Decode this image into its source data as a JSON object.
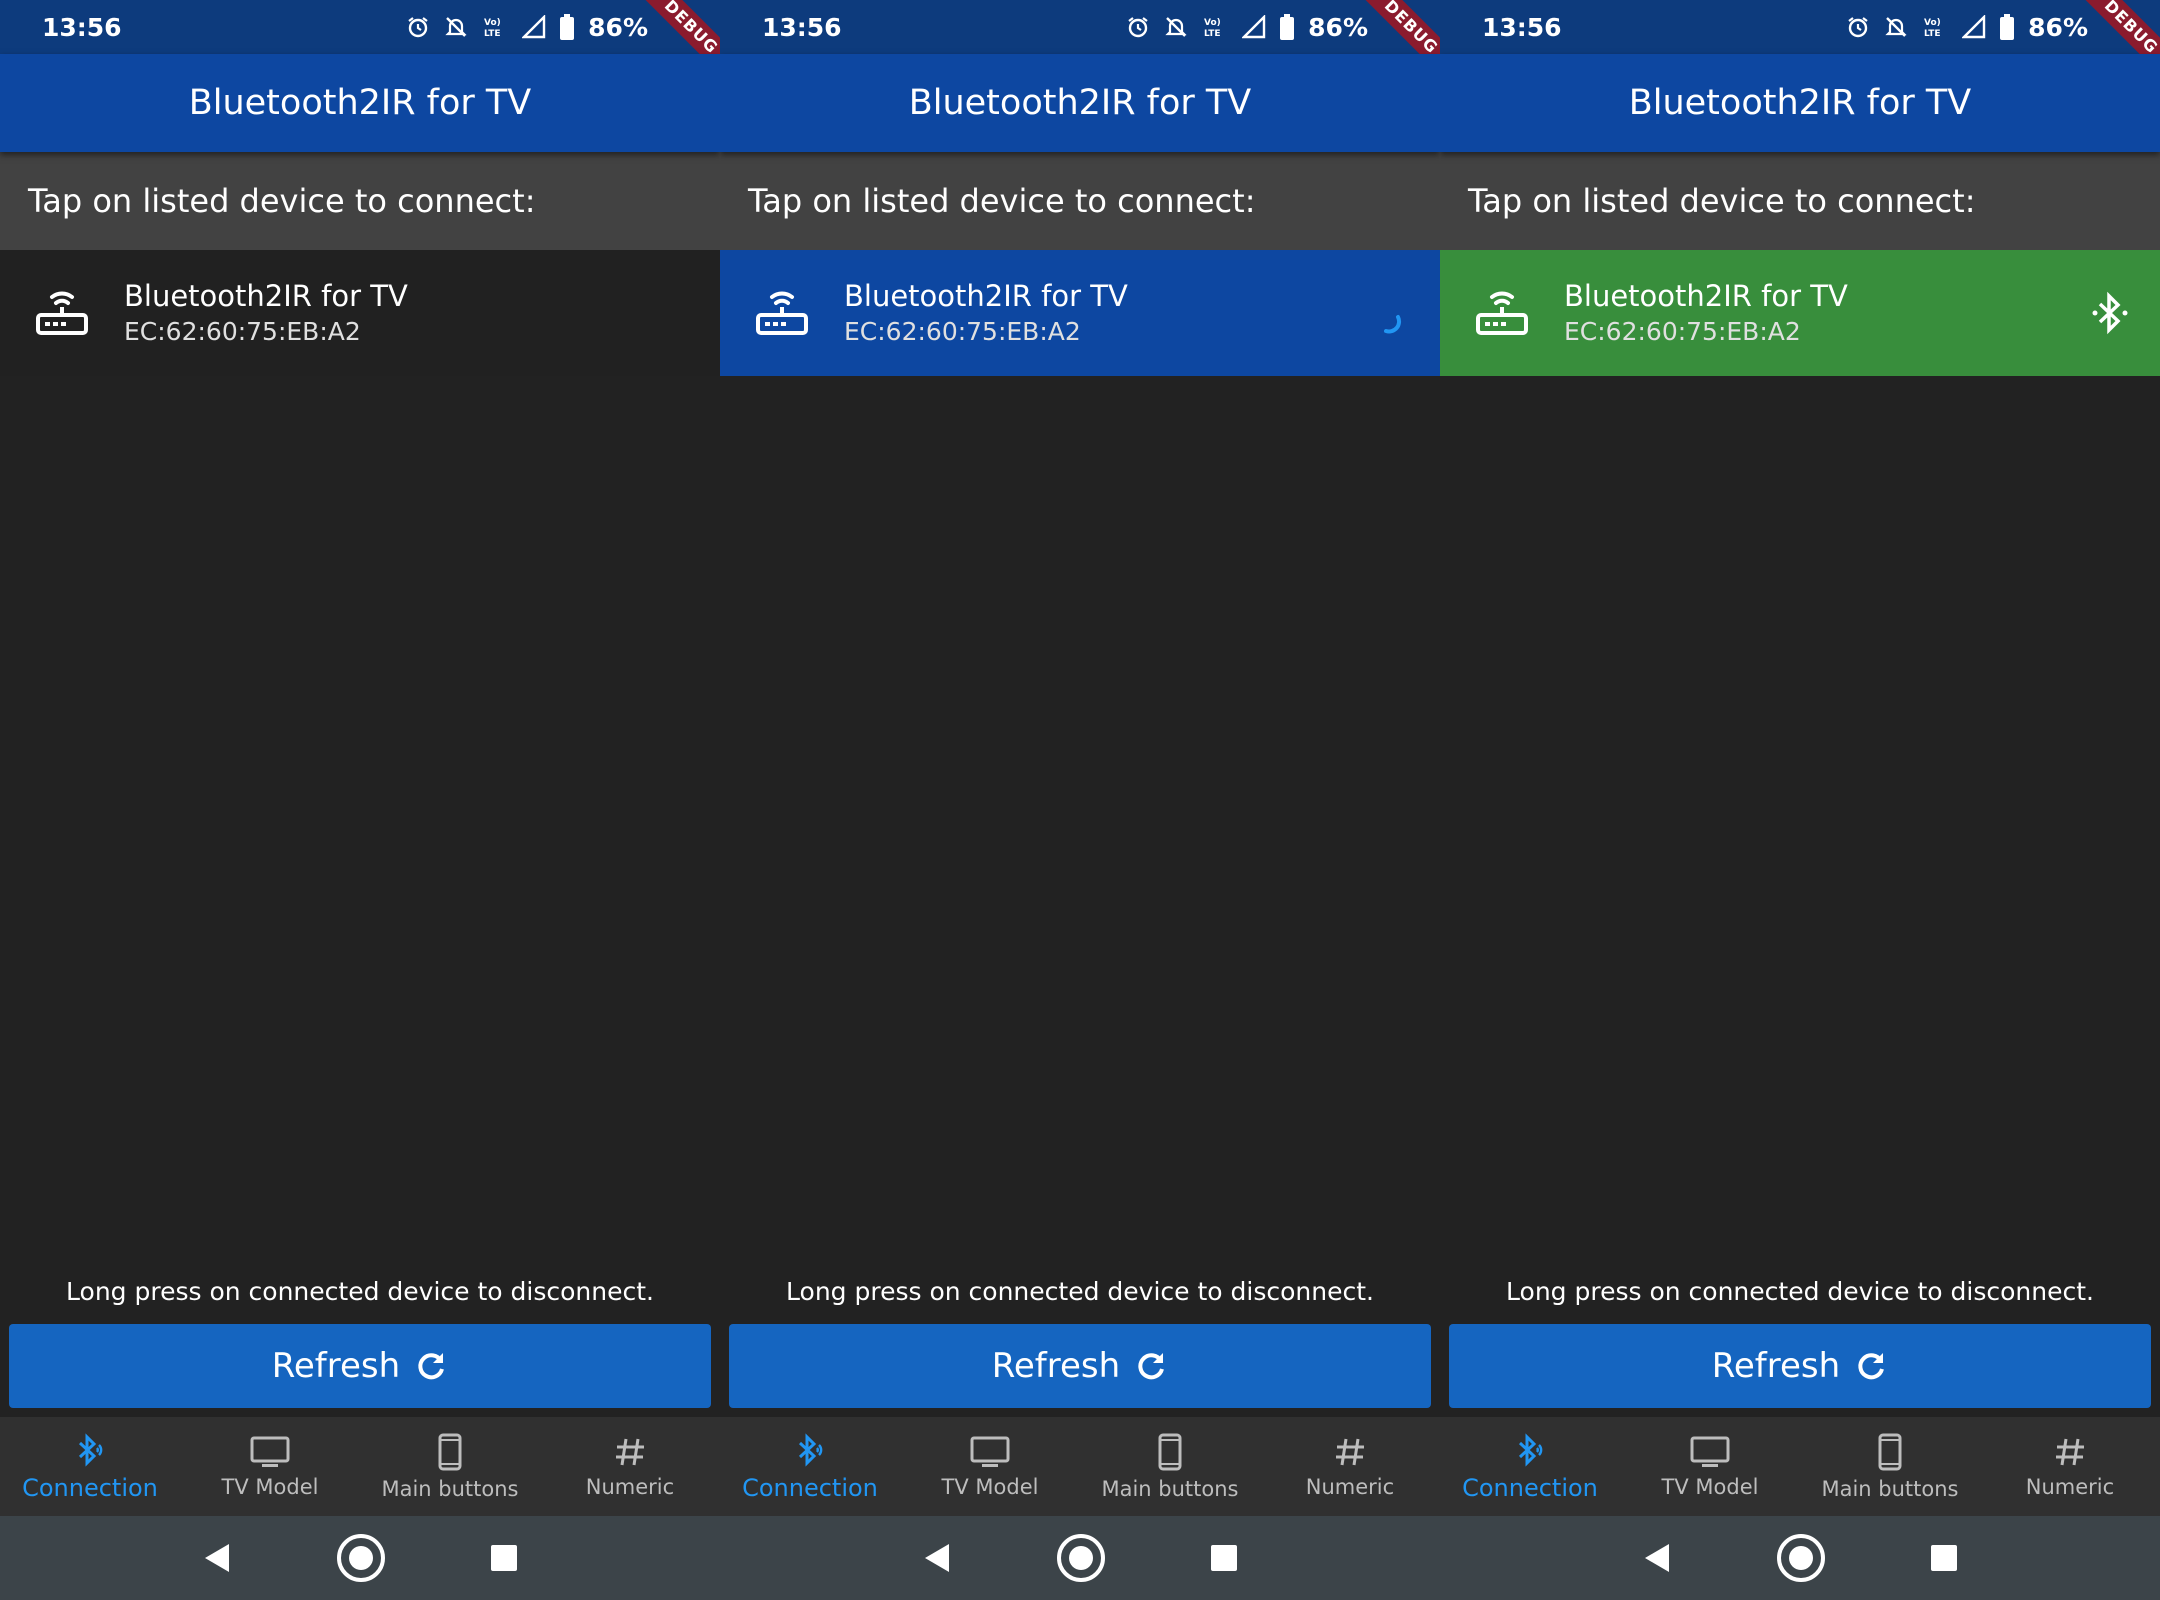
{
  "status": {
    "time": "13:56",
    "battery": "86%",
    "debug": "DEBUG"
  },
  "appbar": {
    "title": "Bluetooth2IR for TV"
  },
  "subheader": {
    "text": "Tap on listed device to connect:"
  },
  "device": {
    "name": "Bluetooth2IR for TV",
    "address": "EC:62:60:75:EB:A2"
  },
  "hint": "Long press on connected device to disconnect.",
  "refresh": {
    "label": "Refresh",
    "icon": "refresh-icon"
  },
  "nav": {
    "items": [
      {
        "label": "Connection",
        "icon": "bluetooth-audio-icon"
      },
      {
        "label": "TV Model",
        "icon": "tv-icon"
      },
      {
        "label": "Main buttons",
        "icon": "phone-icon"
      },
      {
        "label": "Numeric",
        "icon": "hash-icon"
      }
    ]
  },
  "screens": [
    {
      "device_state": "default",
      "trailing_icon": ""
    },
    {
      "device_state": "selected",
      "trailing_icon": "progress-icon"
    },
    {
      "device_state": "connected",
      "trailing_icon": "bluetooth-icon"
    }
  ],
  "colors": {
    "statusbar": "#0d3b7d",
    "appbar": "#0d47a1",
    "subheader": "#424242",
    "background": "#222222",
    "selected": "#0d47a1",
    "connected": "#388e3c",
    "button": "#1565c0",
    "nav_active": "#2196f3",
    "system_nav": "#3c4449"
  }
}
